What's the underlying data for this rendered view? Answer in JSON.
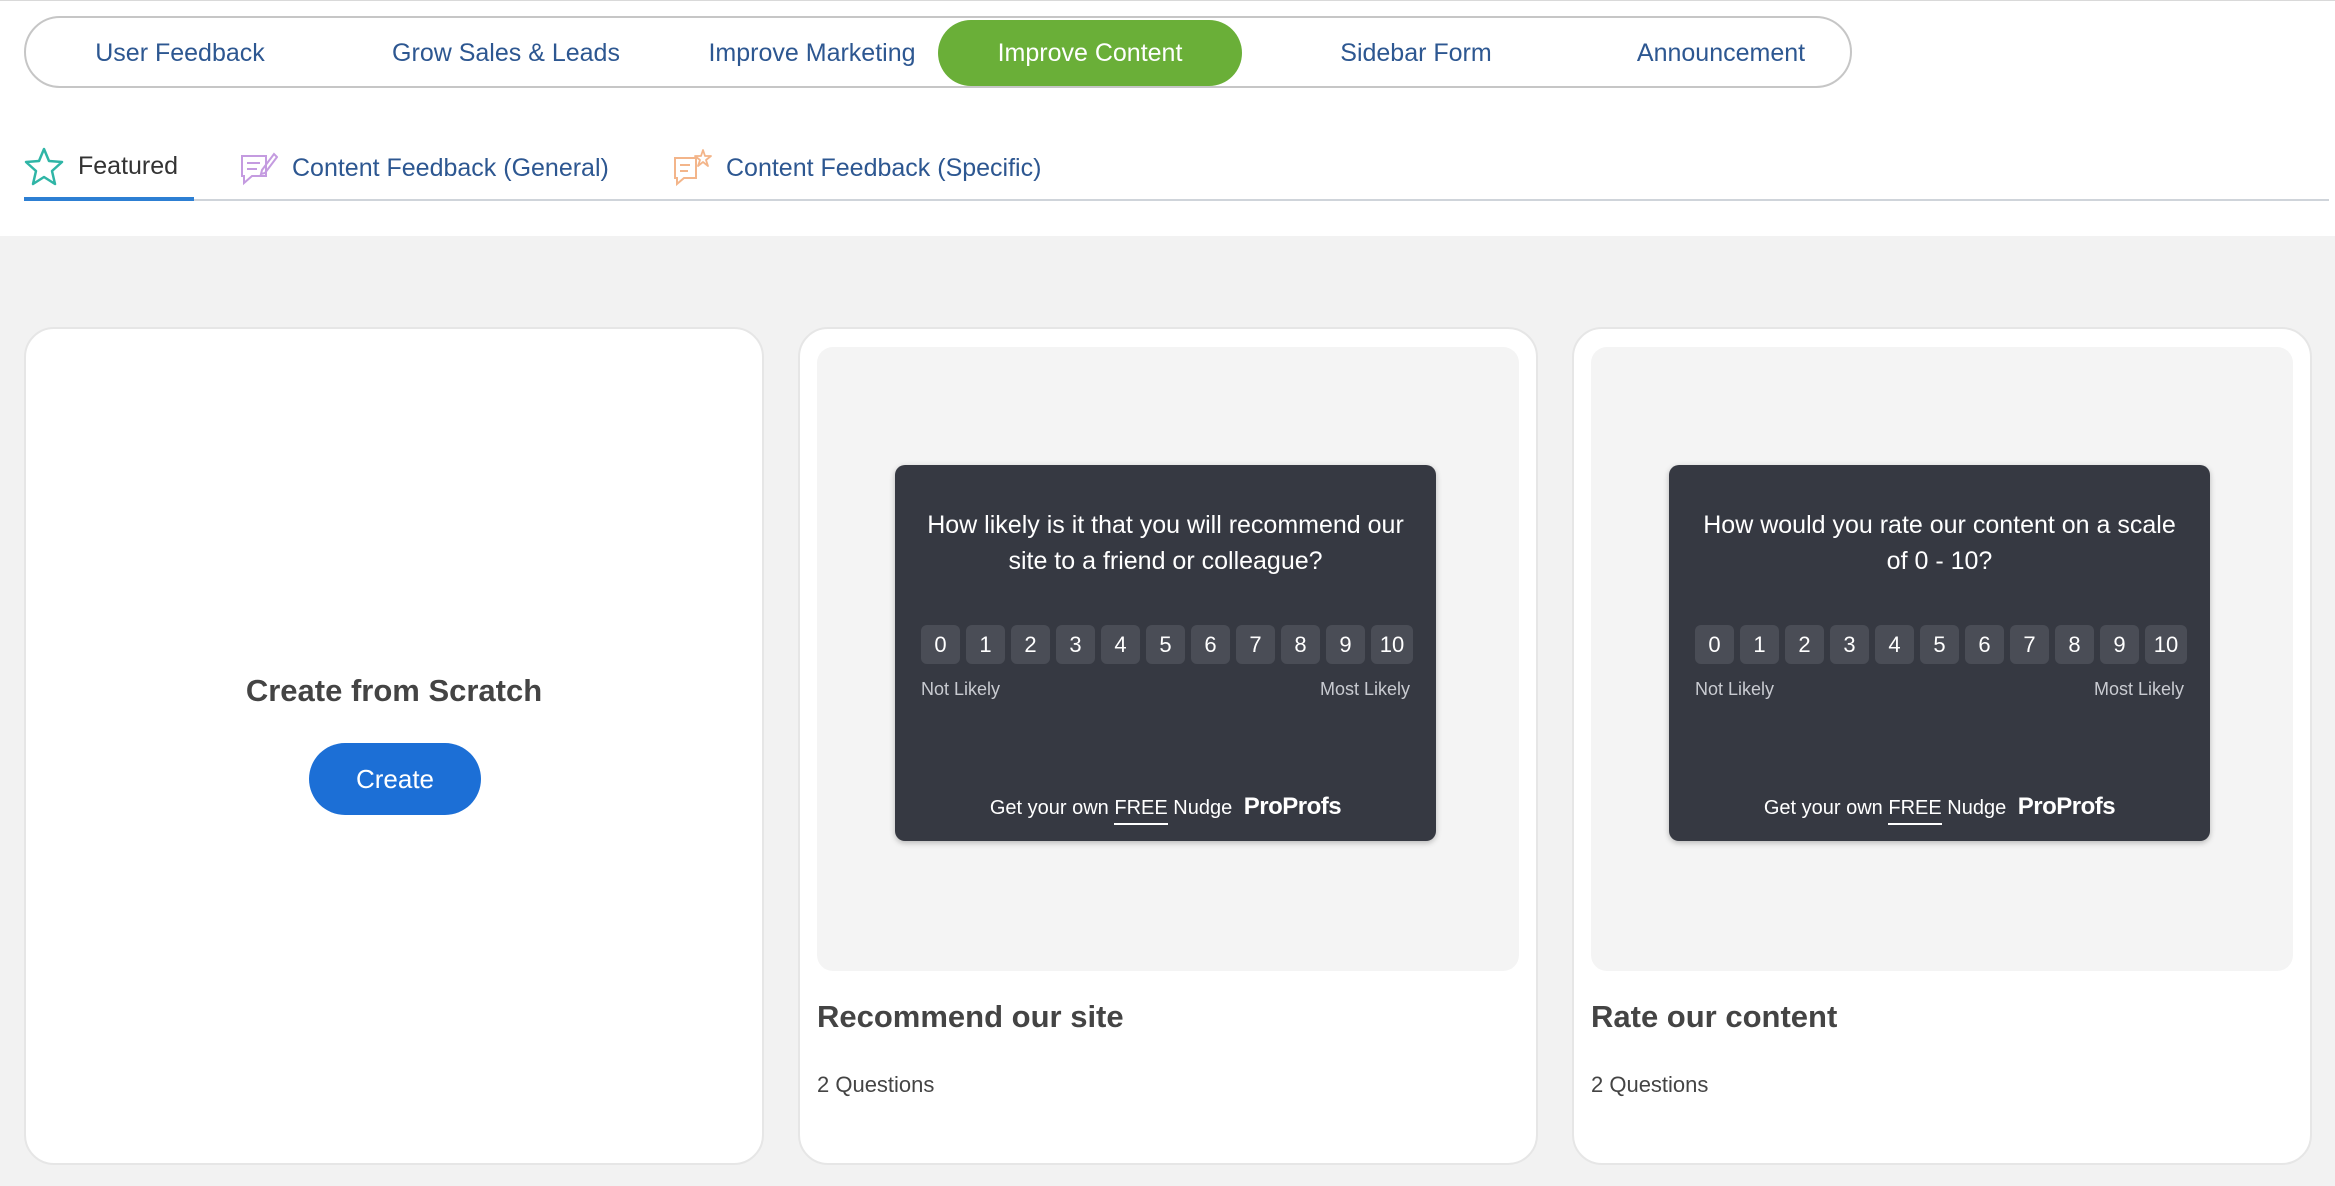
{
  "categories": [
    {
      "label": "User Feedback"
    },
    {
      "label": "Grow Sales & Leads"
    },
    {
      "label": "Improve Marketing"
    },
    {
      "label": "Improve Content",
      "active": true
    },
    {
      "label": "Sidebar Form"
    },
    {
      "label": "Announcement"
    }
  ],
  "sub_tabs": [
    {
      "label": "Featured",
      "icon": "star-icon",
      "active": true
    },
    {
      "label": "Content Feedback (General)",
      "icon": "feedback-edit-icon"
    },
    {
      "label": "Content Feedback (Specific)",
      "icon": "feedback-star-icon"
    }
  ],
  "scratch_card": {
    "title": "Create from Scratch",
    "button": "Create"
  },
  "templates": [
    {
      "question": "How likely is it that you will recommend our site to a friend or colleague?",
      "scale": [
        "0",
        "1",
        "2",
        "3",
        "4",
        "5",
        "6",
        "7",
        "8",
        "9",
        "10"
      ],
      "low_label": "Not Likely",
      "high_label": "Most Likely",
      "footer_prefix": "Get your own",
      "footer_free": "FREE",
      "footer_suffix": "Nudge",
      "brand": "ProProfs",
      "title": "Recommend our site",
      "subtitle": "2 Questions"
    },
    {
      "question": "How would you rate our content on a scale of 0 - 10?",
      "scale": [
        "0",
        "1",
        "2",
        "3",
        "4",
        "5",
        "6",
        "7",
        "8",
        "9",
        "10"
      ],
      "low_label": "Not Likely",
      "high_label": "Most Likely",
      "footer_prefix": "Get your own",
      "footer_free": "FREE",
      "footer_suffix": "Nudge",
      "brand": "ProProfs",
      "title": "Rate our content",
      "subtitle": "2 Questions"
    }
  ],
  "colors": {
    "active_category": "#6aaf38",
    "link": "#2d5791",
    "primary_button": "#1c6fd6",
    "nudge_bg": "#363942"
  }
}
